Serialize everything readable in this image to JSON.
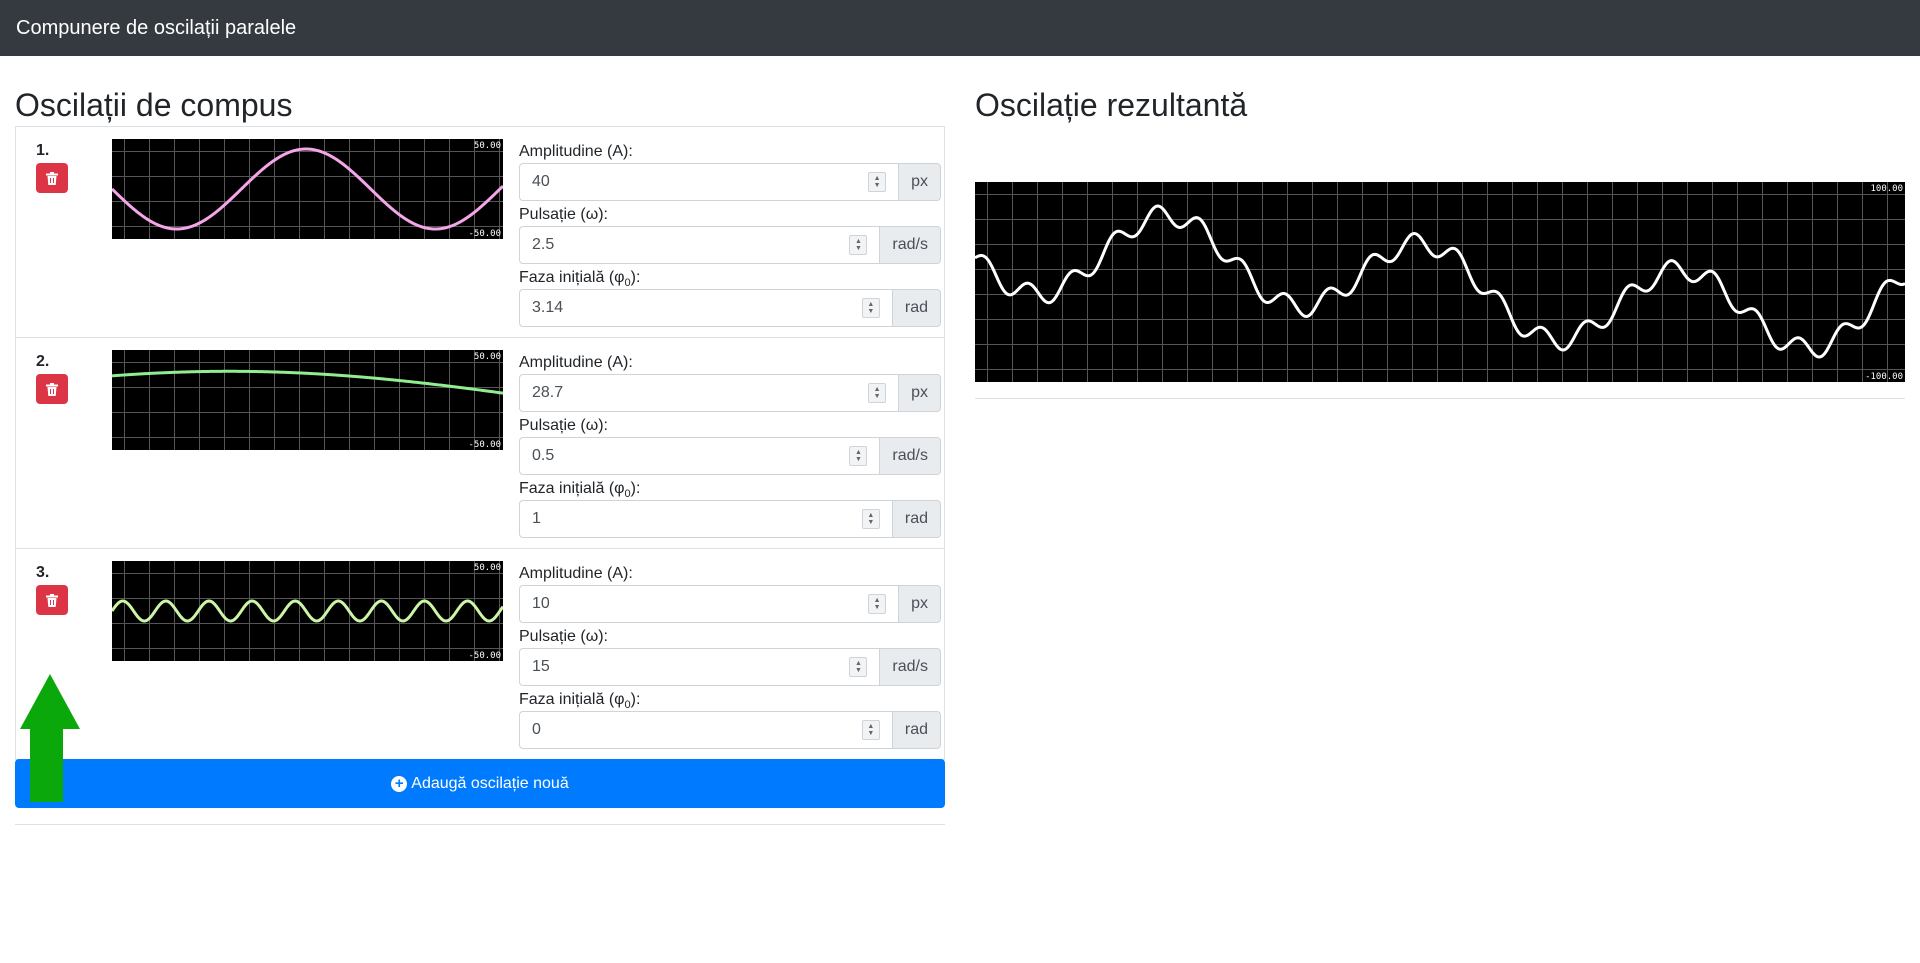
{
  "navbar": {
    "title": "Compunere de oscilații paralele"
  },
  "left": {
    "heading": "Oscilații de compus"
  },
  "right": {
    "heading": "Oscilație rezultantă",
    "ymax_label": "100.00",
    "ymin_label": "-100.00"
  },
  "labels": {
    "amplitude": "Amplitudine (A):",
    "pulsation": "Pulsație (ω):",
    "phase": "Faza inițială (φ",
    "phase_sub": "0",
    "phase_end": "):"
  },
  "oscillations": [
    {
      "number": "1.",
      "amplitude": "40",
      "amplitude_unit": "px",
      "pulsation": "2.5",
      "pulsation_unit": "rad/s",
      "phase": "3.14",
      "phase_unit": "rad",
      "color": "#f4a6e8",
      "ymax_label": "50.00",
      "ymin_label": "-50.00"
    },
    {
      "number": "2.",
      "amplitude": "28.7",
      "amplitude_unit": "px",
      "pulsation": "0.5",
      "pulsation_unit": "rad/s",
      "phase": "1",
      "phase_unit": "rad",
      "color": "#90ee90",
      "ymax_label": "50.00",
      "ymin_label": "-50.00"
    },
    {
      "number": "3.",
      "amplitude": "10",
      "amplitude_unit": "px",
      "pulsation": "15",
      "pulsation_unit": "rad/s",
      "phase": "0",
      "phase_unit": "rad",
      "color": "#ccf5a6",
      "ymax_label": "50.00",
      "ymin_label": "-50.00"
    }
  ],
  "add_button": {
    "label": "Adaugă oscilație nouă"
  },
  "colors": {
    "navbar": "#343a40",
    "danger": "#dc3545",
    "primary": "#007bff",
    "arrow": "#0aa80a",
    "result_wave": "#ffffff"
  }
}
